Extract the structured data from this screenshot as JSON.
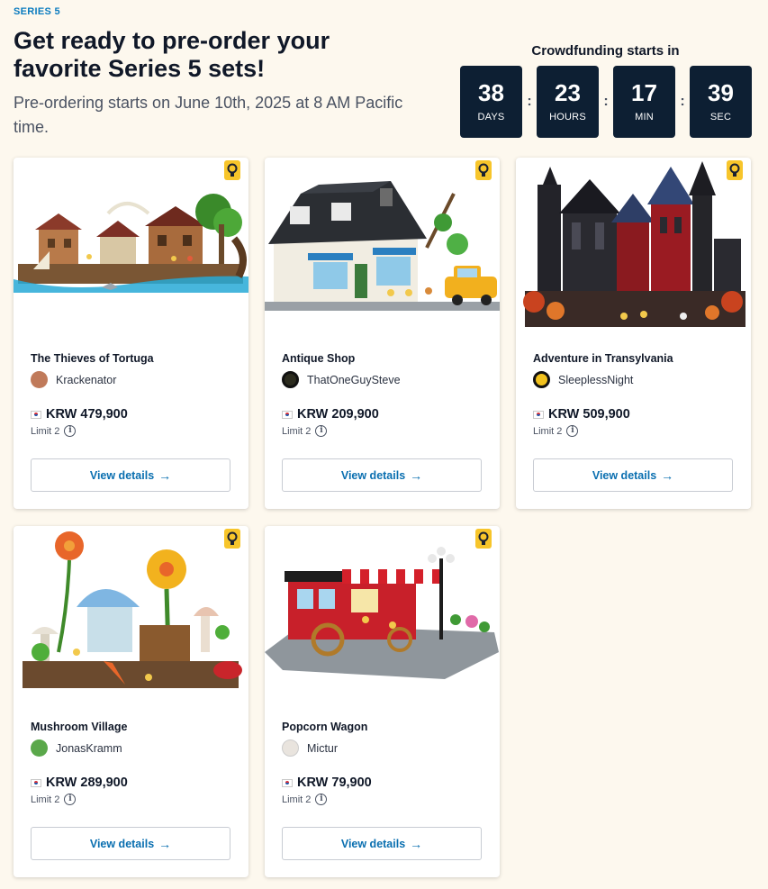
{
  "header": {
    "eyebrow": "SERIES 5",
    "headline": "Get ready to pre-order your favorite Series 5 sets!",
    "subline": "Pre-ordering starts on June 10th, 2025 at 8 AM Pacific time."
  },
  "countdown": {
    "title": "Crowdfunding starts in",
    "separator": ":",
    "units": [
      {
        "value": "38",
        "label": "DAYS"
      },
      {
        "value": "23",
        "label": "HOURS"
      },
      {
        "value": "17",
        "label": "MIN"
      },
      {
        "value": "39",
        "label": "SEC"
      }
    ]
  },
  "products": [
    {
      "name": "The Thieves of Tortuga",
      "creator": "Krackenator",
      "price": "KRW 479,900",
      "limit": "Limit 2",
      "button": "View details",
      "icon": "pirate-port-image"
    },
    {
      "name": "Antique Shop",
      "creator": "ThatOneGuySteve",
      "price": "KRW 209,900",
      "limit": "Limit 2",
      "button": "View details",
      "icon": "antique-shop-image"
    },
    {
      "name": "Adventure in Transylvania",
      "creator": "SleeplessNight",
      "price": "KRW 509,900",
      "limit": "Limit 2",
      "button": "View details",
      "icon": "castle-image"
    },
    {
      "name": "Mushroom Village",
      "creator": "JonasKramm",
      "price": "KRW 289,900",
      "limit": "Limit 2",
      "button": "View details",
      "icon": "mushroom-village-image"
    },
    {
      "name": "Popcorn Wagon",
      "creator": "Mictur",
      "price": "KRW 79,900",
      "limit": "Limit 2",
      "button": "View details",
      "icon": "popcorn-wagon-image"
    }
  ],
  "colors": {
    "background": "#fdf8ee",
    "countdown_tile": "#0d1f33",
    "accent_link": "#0a6fb0",
    "badge": "#f7c52b"
  }
}
